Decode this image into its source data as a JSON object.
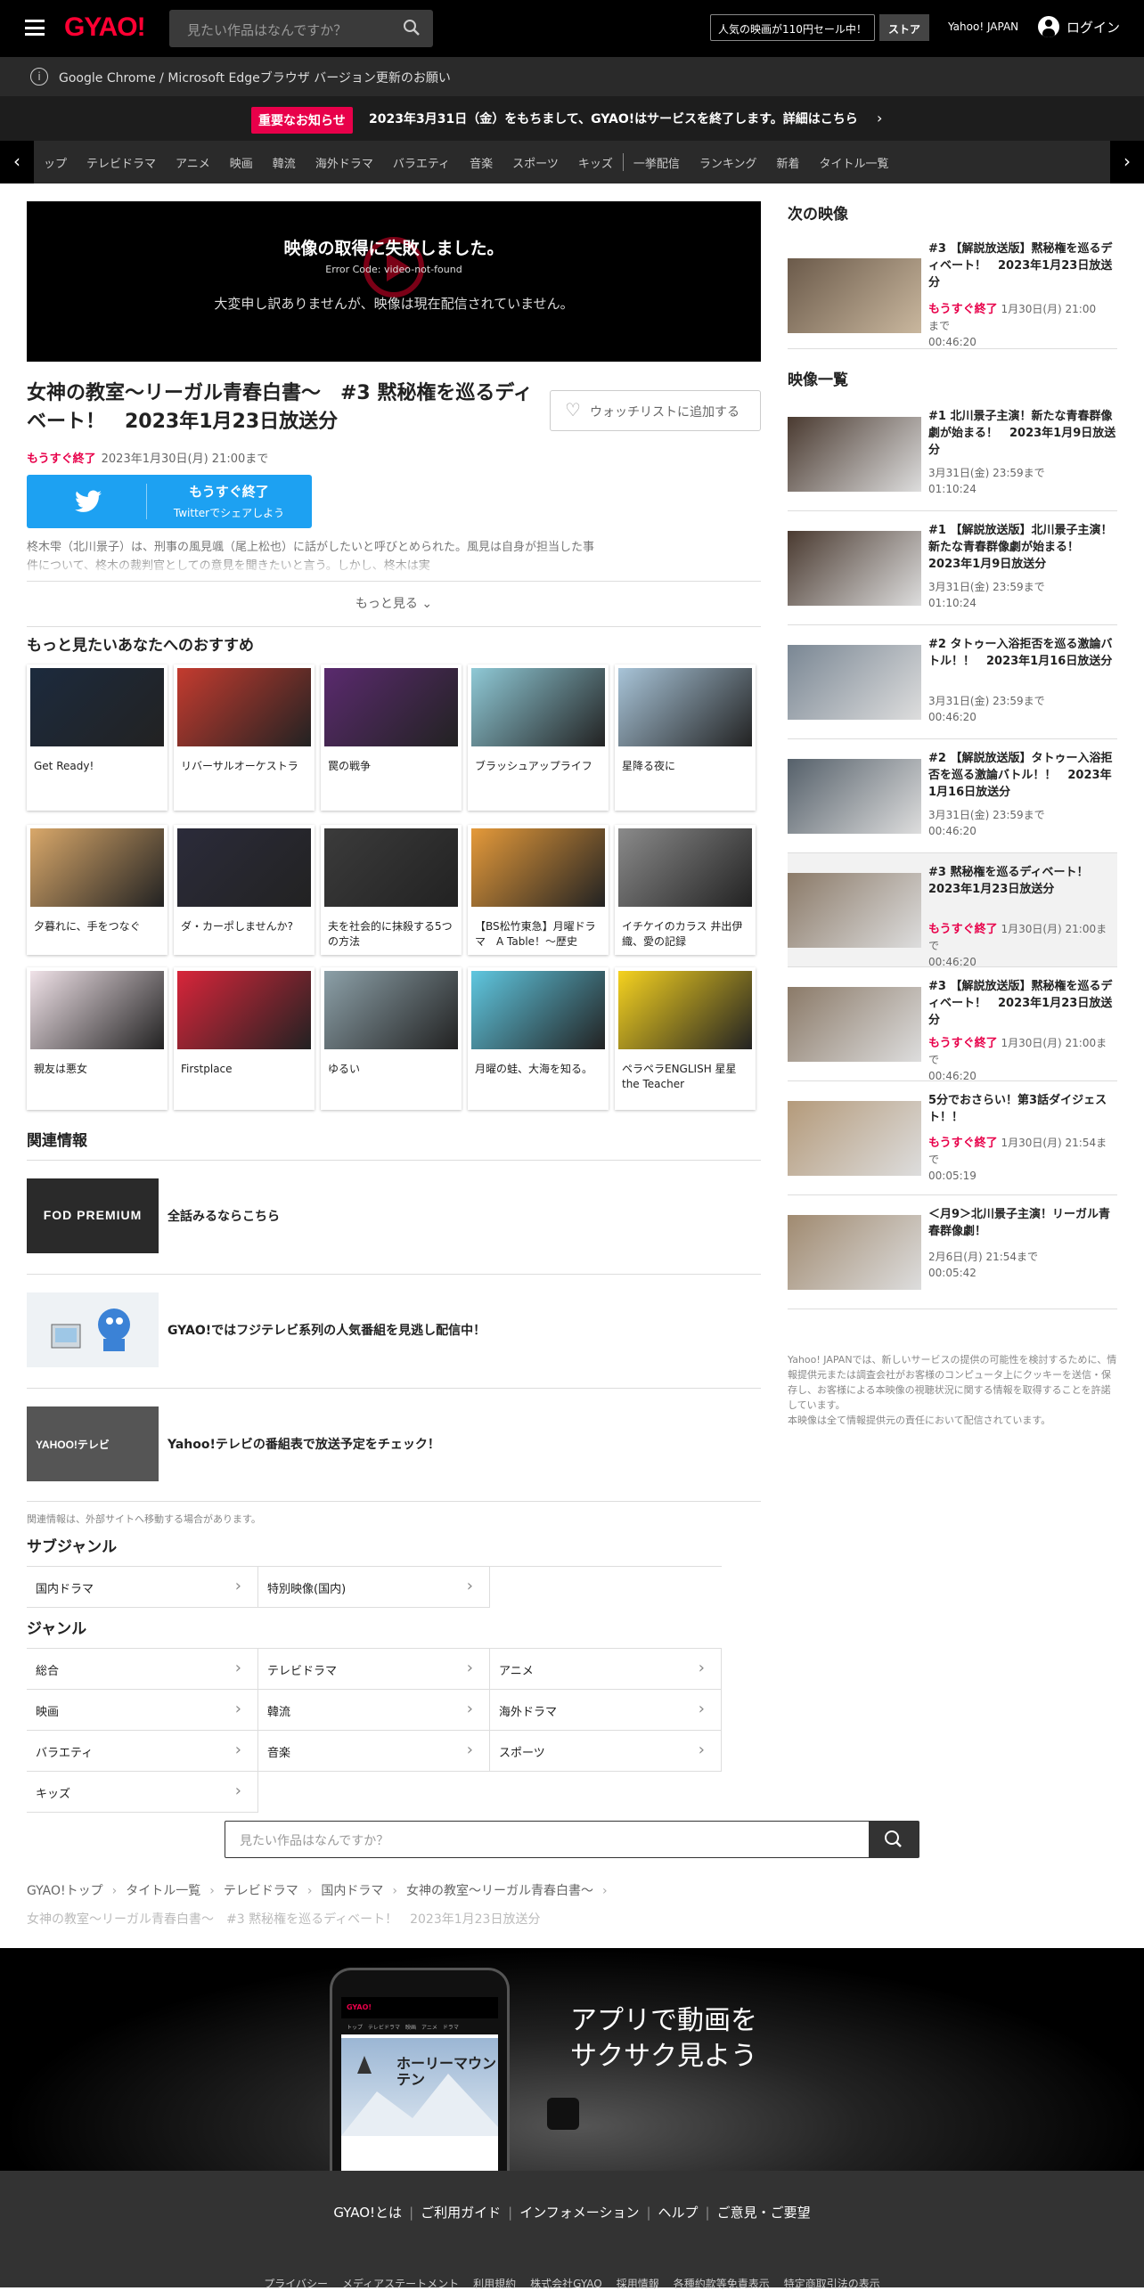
{
  "header": {
    "logo": "GYAO!",
    "search_placeholder": "見たい作品はなんですか？",
    "sale_label": "人気の映画が110円セール中！",
    "store_label": "ストア",
    "yahoo_label": "Yahoo! JAPAN",
    "login_label": "ログイン"
  },
  "browser_notice": "Google Chrome / Microsoft Edgeブラウザ バージョン更新のお願い",
  "important": {
    "badge": "重要なお知らせ",
    "message": "2023年3月31日（金）をもちまして、GYAO!はサービスを終了します。詳細はこちら"
  },
  "nav": {
    "items": [
      "ップ",
      "テレビドラマ",
      "アニメ",
      "映画",
      "韓流",
      "海外ドラマ",
      "バラエティ",
      "音楽",
      "スポーツ",
      "キッズ"
    ],
    "items2": [
      "一挙配信",
      "ランキング",
      "新着",
      "タイトル一覧"
    ]
  },
  "player": {
    "error_title": "映像の取得に失敗しました。",
    "error_code": "Error Code: video-not-found",
    "error_sub": "大変申し訳ありませんが、映像は現在配信されていません。"
  },
  "episode": {
    "title": "女神の教室～リーガル青春白書～　#3 黙秘権を巡るディベート！　2023年1月23日放送分",
    "watchlist_label": "ウォッチリストに追加する",
    "soon_label": "もうすぐ終了",
    "until": "2023年1月30日(月) 21:00まで",
    "twitter_main": "もうすぐ終了",
    "twitter_sub": "Twitterでシェアしよう",
    "synopsis": "柊木雫（北川景子）は、刑事の風見颯（尾上松也）に話がしたいと呼びとめられた。風見は自身が担当した事件について、柊木の裁判官としての意見を聞きたいと言う。しかし、柊木は実",
    "more_label": "もっと見る"
  },
  "recommend": {
    "heading": "もっと見たいあなたへのおすすめ",
    "items": [
      {
        "title": "Get Ready!",
        "color": "#1c2a3d"
      },
      {
        "title": "リバーサルオーケストラ",
        "color": "#c43b2f"
      },
      {
        "title": "罠の戦争",
        "color": "#5a2a6e"
      },
      {
        "title": "ブラッシュアップライフ",
        "color": "#8fc9d6"
      },
      {
        "title": "星降る夜に",
        "color": "#a8c4d8"
      },
      {
        "title": "夕暮れに、手をつなぐ",
        "color": "#d9a86a"
      },
      {
        "title": "ダ・カーポしませんか?",
        "color": "#2b2b3a"
      },
      {
        "title": "夫を社会的に抹殺する5つの方法",
        "color": "#3b3b3b"
      },
      {
        "title": "【BS松竹東急】月曜ドラマ　A Table！～歴史",
        "color": "#e59a3a"
      },
      {
        "title": "イチケイのカラス 井出伊織、愛の記録",
        "color": "#8a8a8a"
      },
      {
        "title": "親友は悪女",
        "color": "#f0e2e8"
      },
      {
        "title": "Firstplace",
        "color": "#d8253a"
      },
      {
        "title": "ゆるい",
        "color": "#8ca0a8"
      },
      {
        "title": "月曜の蛙、大海を知る。",
        "color": "#5fc7e0"
      },
      {
        "title": "ペラペラENGLISH 星星 the Teacher",
        "color": "#f5d21f"
      }
    ]
  },
  "related": {
    "heading": "関連情報",
    "items": [
      {
        "label": "全話みるならこちら",
        "img_text": "FOD PREMIUM"
      },
      {
        "label": "GYAO!ではフジテレビ系列の人気番組を見逃し配信中！",
        "img_text": ""
      },
      {
        "label": "Yahoo!テレビの番組表で放送予定をチェック！",
        "img_text": "YAHOO!テレビ"
      }
    ],
    "note": "関連情報は、外部サイトへ移動する場合があります。"
  },
  "subgenre": {
    "heading": "サブジャンル",
    "items": [
      "国内ドラマ",
      "特別映像(国内)"
    ]
  },
  "genre": {
    "heading": "ジャンル",
    "items": [
      "総合",
      "テレビドラマ",
      "アニメ",
      "映画",
      "韓流",
      "海外ドラマ",
      "バラエティ",
      "音楽",
      "スポーツ",
      "キッズ"
    ]
  },
  "bottom_search_placeholder": "見たい作品はなんですか？",
  "breadcrumb": {
    "items": [
      "GYAO!トップ",
      "タイトル一覧",
      "テレビドラマ",
      "国内ドラマ",
      "女神の教室～リーガル青春白書～"
    ],
    "current": "女神の教室～リーガル青春白書～　#3 黙秘権を巡るディベート！　2023年1月23日放送分"
  },
  "app_banner": {
    "line1": "アプリで動画を",
    "line2": "サクサク見よう",
    "phone_logo": "GYAO!",
    "phone_tabs": "トップ　テレビドラマ　映画　アニメ　ドラマ",
    "phone_movie": "ホーリーマウンテン"
  },
  "footer": {
    "links": [
      "GYAO!とは",
      "ご利用ガイド",
      "インフォメーション",
      "ヘルプ",
      "ご意見・ご要望"
    ],
    "sub_links": [
      "プライバシー",
      "メディアステートメント",
      "利用規約",
      "株式会社GYAO",
      "採用情報",
      "各種約款等免責表示",
      "特定商取引法の表示"
    ]
  },
  "next_video": {
    "heading": "次の映像",
    "item": {
      "title": "#3 【解説放送版】黙秘権を巡るディベート！　2023年1月23日放送分",
      "soon": "もうすぐ終了",
      "date": "1月30日(月) 21:00",
      "suffix": "まで",
      "duration": "00:46:20"
    }
  },
  "video_list": {
    "heading": "映像一覧",
    "items": [
      {
        "title": "#1 北川景子主演！新たな青春群像劇が始まる！　2023年1月9日放送分",
        "soon": "",
        "date": "3月31日(金) 23:59まで",
        "duration": "01:10:24"
      },
      {
        "title": "#1 【解説放送版】北川景子主演！新たな青春群像劇が始まる！　2023年1月9日放送分",
        "soon": "",
        "date": "3月31日(金) 23:59まで",
        "duration": "01:10:24"
      },
      {
        "title": "#2 タトゥー入浴拒否を巡る激論バトル！！　2023年1月16日放送分",
        "soon": "",
        "date": "3月31日(金) 23:59まで",
        "duration": "00:46:20"
      },
      {
        "title": "#2 【解説放送版】タトゥー入浴拒否を巡る激論バトル！！　2023年1月16日放送分",
        "soon": "",
        "date": "3月31日(金) 23:59まで",
        "duration": "00:46:20"
      },
      {
        "title": "#3 黙秘権を巡るディベート！　2023年1月23日放送分",
        "soon": "もうすぐ終了",
        "date": "1月30日(月) 21:00まで",
        "duration": "00:46:20"
      },
      {
        "title": "#3 【解説放送版】黙秘権を巡るディベート！　2023年1月23日放送分",
        "soon": "もうすぐ終了",
        "date": "1月30日(月) 21:00まで",
        "duration": "00:46:20"
      },
      {
        "title": "5分でおさらい！第3話ダイジェスト！！",
        "soon": "もうすぐ終了",
        "date": "1月30日(月) 21:54まで",
        "duration": "00:05:19"
      },
      {
        "title": "＜月9＞北川景子主演！リーガル青春群像劇！",
        "soon": "",
        "date": "2月6日(月) 21:54まで",
        "duration": "00:05:42"
      }
    ]
  },
  "right_note": "Yahoo! JAPANでは、新しいサービスの提供の可能性を検討するために、情報提供元または調査会社がお客様のコンピュータ上にクッキーを送信・保存し、お客様による本映像の視聴状況に関する情報を取得することを許諾しています。\n本映像は全て情報提供元の責任において配信されています。"
}
